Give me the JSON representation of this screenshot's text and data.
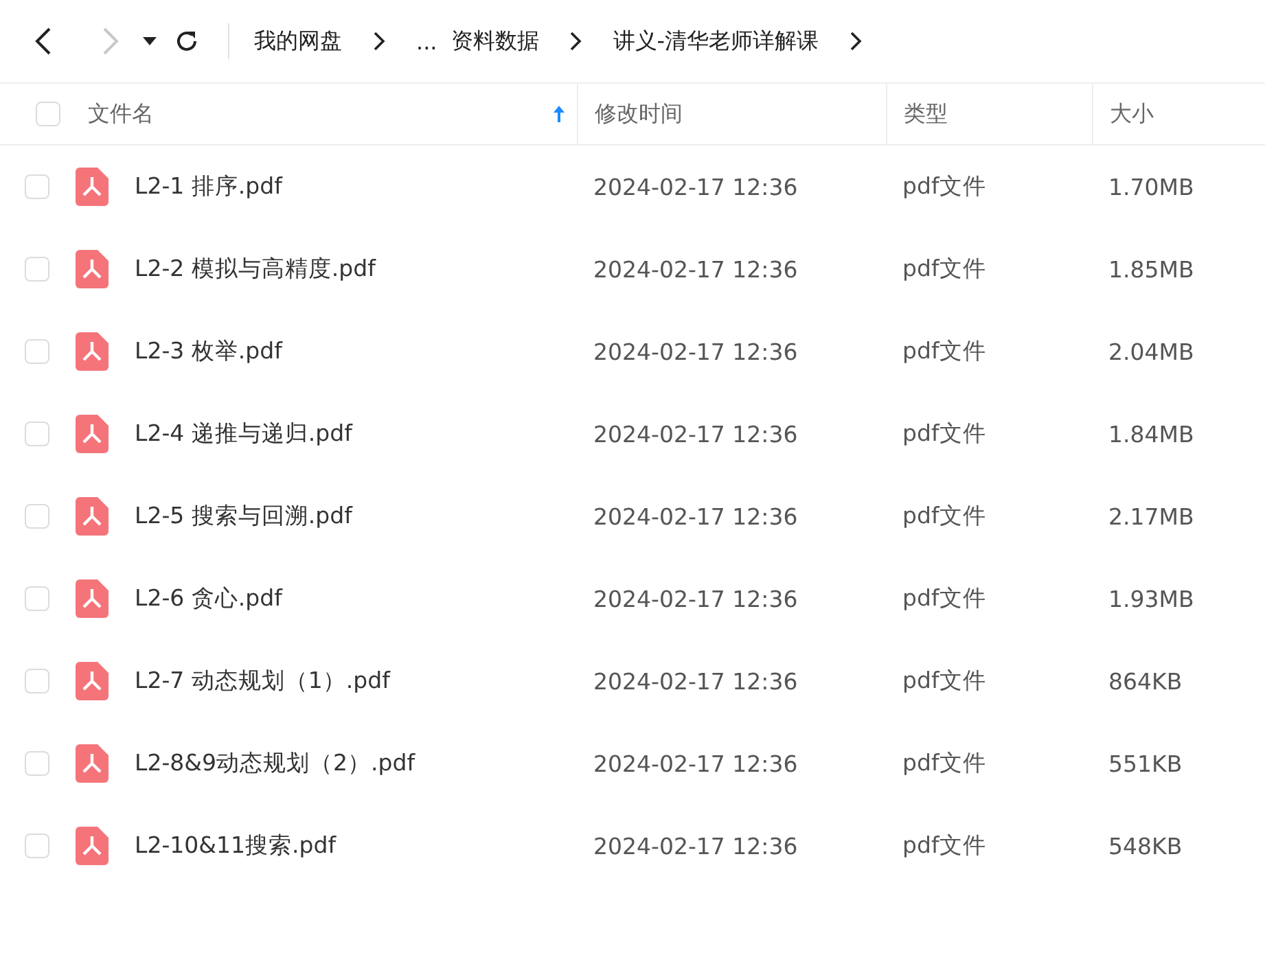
{
  "toolbar": {
    "back_disabled": false,
    "forward_disabled": true
  },
  "breadcrumbs": [
    {
      "label": "我的网盘"
    },
    {
      "label": "..."
    },
    {
      "label": "资料数据"
    },
    {
      "label": "讲义-清华老师详解课"
    }
  ],
  "table": {
    "select_all": {
      "checked": false
    },
    "columns": [
      {
        "label": "文件名",
        "sorted": true
      },
      {
        "label": "修改时间",
        "sorted": false
      },
      {
        "label": "类型",
        "sorted": false
      },
      {
        "label": "大小",
        "sorted": false
      }
    ],
    "rows": [
      {
        "checked": false,
        "name": "L2-1 排序.pdf",
        "modified": "2024-02-17 12:36",
        "type": "pdf文件",
        "size": "1.70MB"
      },
      {
        "checked": false,
        "name": "L2-2 模拟与高精度.pdf",
        "modified": "2024-02-17 12:36",
        "type": "pdf文件",
        "size": "1.85MB"
      },
      {
        "checked": false,
        "name": "L2-3 枚举.pdf",
        "modified": "2024-02-17 12:36",
        "type": "pdf文件",
        "size": "2.04MB"
      },
      {
        "checked": false,
        "name": "L2-4 递推与递归.pdf",
        "modified": "2024-02-17 12:36",
        "type": "pdf文件",
        "size": "1.84MB"
      },
      {
        "checked": false,
        "name": "L2-5 搜索与回溯.pdf",
        "modified": "2024-02-17 12:36",
        "type": "pdf文件",
        "size": "2.17MB"
      },
      {
        "checked": false,
        "name": "L2-6 贪心.pdf",
        "modified": "2024-02-17 12:36",
        "type": "pdf文件",
        "size": "1.93MB"
      },
      {
        "checked": false,
        "name": "L2-7 动态规划（1）.pdf",
        "modified": "2024-02-17 12:36",
        "type": "pdf文件",
        "size": "864KB"
      },
      {
        "checked": false,
        "name": "L2-8&9动态规划（2）.pdf",
        "modified": "2024-02-17 12:36",
        "type": "pdf文件",
        "size": "551KB"
      },
      {
        "checked": false,
        "name": "L2-10&11搜索.pdf",
        "modified": "2024-02-17 12:36",
        "type": "pdf文件",
        "size": "548KB"
      }
    ]
  }
}
